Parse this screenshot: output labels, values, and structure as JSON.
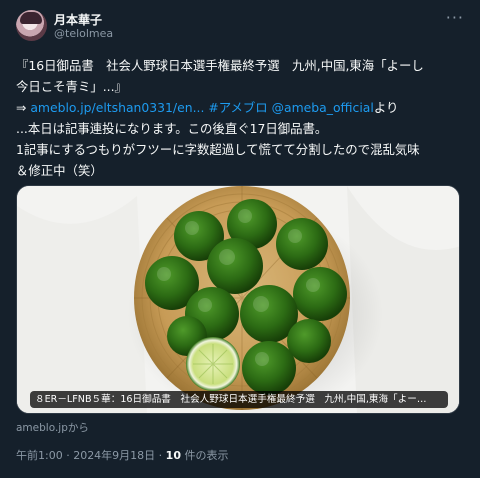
{
  "author": {
    "display_name": "月本華子",
    "handle": "@telolmea"
  },
  "more_label": "···",
  "tweet": {
    "line1": "『16日御品書　社会人野球日本選手権最終予選　九州,中国,東海「よーし",
    "line2": "今日こそ青ミ」...』",
    "arrow": "⇒ ",
    "link_url": "ameblo.jp/eltshan0331/en...",
    "hashtag": "#アメブロ",
    "mention": "@ameba_official",
    "suffix": "より",
    "line4": "...本日は記事連投になります。この後直ぐ17日御品書。",
    "line5": "1記事にするつもりがフツーに字数超過して慌てて分割したので混乱気味",
    "line6": "＆修正中（笑）"
  },
  "card": {
    "caption": "８ER－LFNB５華：16日御品書　社会人野球日本選手権最終予選　九州,中国,東海「よー…",
    "source": "ameblo.jpから"
  },
  "meta": {
    "timestamp": "午前1:00 · 2024年9月18日 · ",
    "views_count": "10",
    "views_label": " 件の表示"
  }
}
